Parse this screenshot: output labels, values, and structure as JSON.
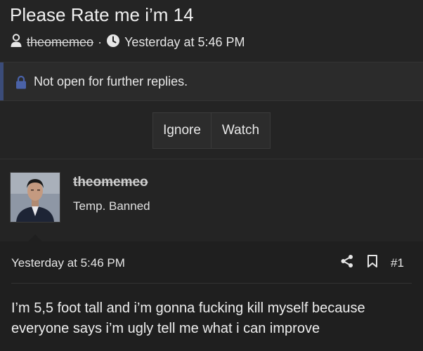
{
  "thread": {
    "title": "Please Rate me i’m 14",
    "author": "theomemeo",
    "separator": "·",
    "timestamp": "Yesterday at 5:46 PM"
  },
  "notice": {
    "text": "Not open for further replies.",
    "accent_color": "#3b4c79"
  },
  "actions": {
    "ignore_label": "Ignore",
    "watch_label": "Watch"
  },
  "poster": {
    "username": "theomemeo",
    "user_title": "Temp. Banned"
  },
  "post": {
    "date": "Yesterday at 5:46 PM",
    "number": "#1",
    "body": "I’m 5,5 foot tall and i’m gonna fucking kill myself because everyone says i’m ugly tell me what i can improve"
  },
  "icons": [
    "user-icon",
    "clock-icon",
    "lock-icon",
    "share-icon",
    "bookmark-icon"
  ]
}
